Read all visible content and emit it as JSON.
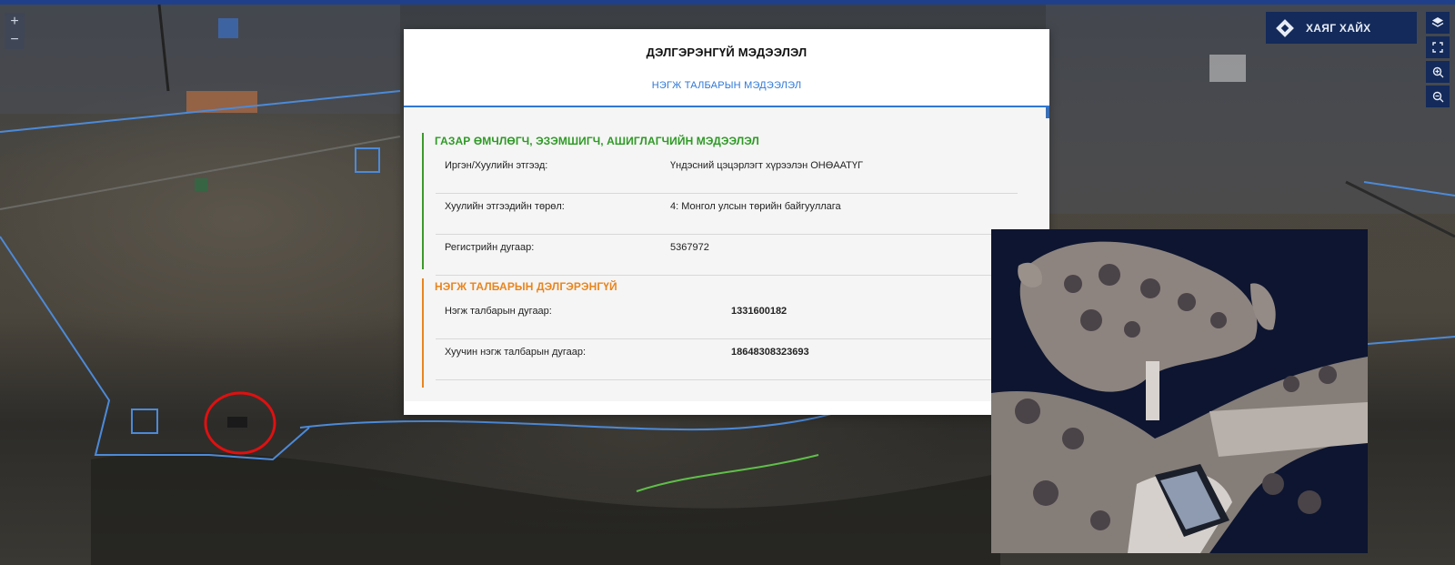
{
  "map": {
    "zoom_in": "+",
    "zoom_out": "−"
  },
  "toolbar": {
    "address_search": "ХАЯГ ХАЙХ",
    "layers_icon": "layers-icon",
    "fullscreen_icon": "fullscreen-icon",
    "zoom_in_icon": "zoom-in-icon",
    "zoom_out_icon": "zoom-out-icon"
  },
  "modal": {
    "title": "ДЭЛГЭРЭНГҮЙ МЭДЭЭЛЭЛ",
    "tab": "НЭГЖ ТАЛБАРЫН МЭДЭЭЛЭЛ",
    "owner_section": {
      "heading": "ГАЗАР ӨМЧЛӨГЧ, ЭЗЭМШИГЧ, АШИГЛАГЧИЙН МЭДЭЭЛЭЛ",
      "rows": [
        {
          "label": "Иргэн/Хуулийн этгээд:",
          "value": "Үндэсний цэцэрлэгт хүрээлэн ОНӨААТҮГ"
        },
        {
          "label": "Хуулийн этгээдийн төрөл:",
          "value": "4: Монгол улсын төрийн байгууллага"
        },
        {
          "label": "Регистрийн дугаар:",
          "value": "5367972"
        }
      ]
    },
    "parcel_section": {
      "heading": "НЭГЖ ТАЛБАРЫН ДЭЛГЭРЭНГҮЙ",
      "rows": [
        {
          "label": "Нэгж талбарын дугаар:",
          "value": "1331600182"
        },
        {
          "label": "Хуучин нэгж талбарын дугаар:",
          "value": "18648308323693"
        }
      ]
    }
  },
  "colors": {
    "accent_blue": "#2f78d6",
    "owner_green": "#2e9a25",
    "parcel_orange": "#e8851f",
    "nav_dark": "#132a5a",
    "highlight_red": "#e01010"
  }
}
